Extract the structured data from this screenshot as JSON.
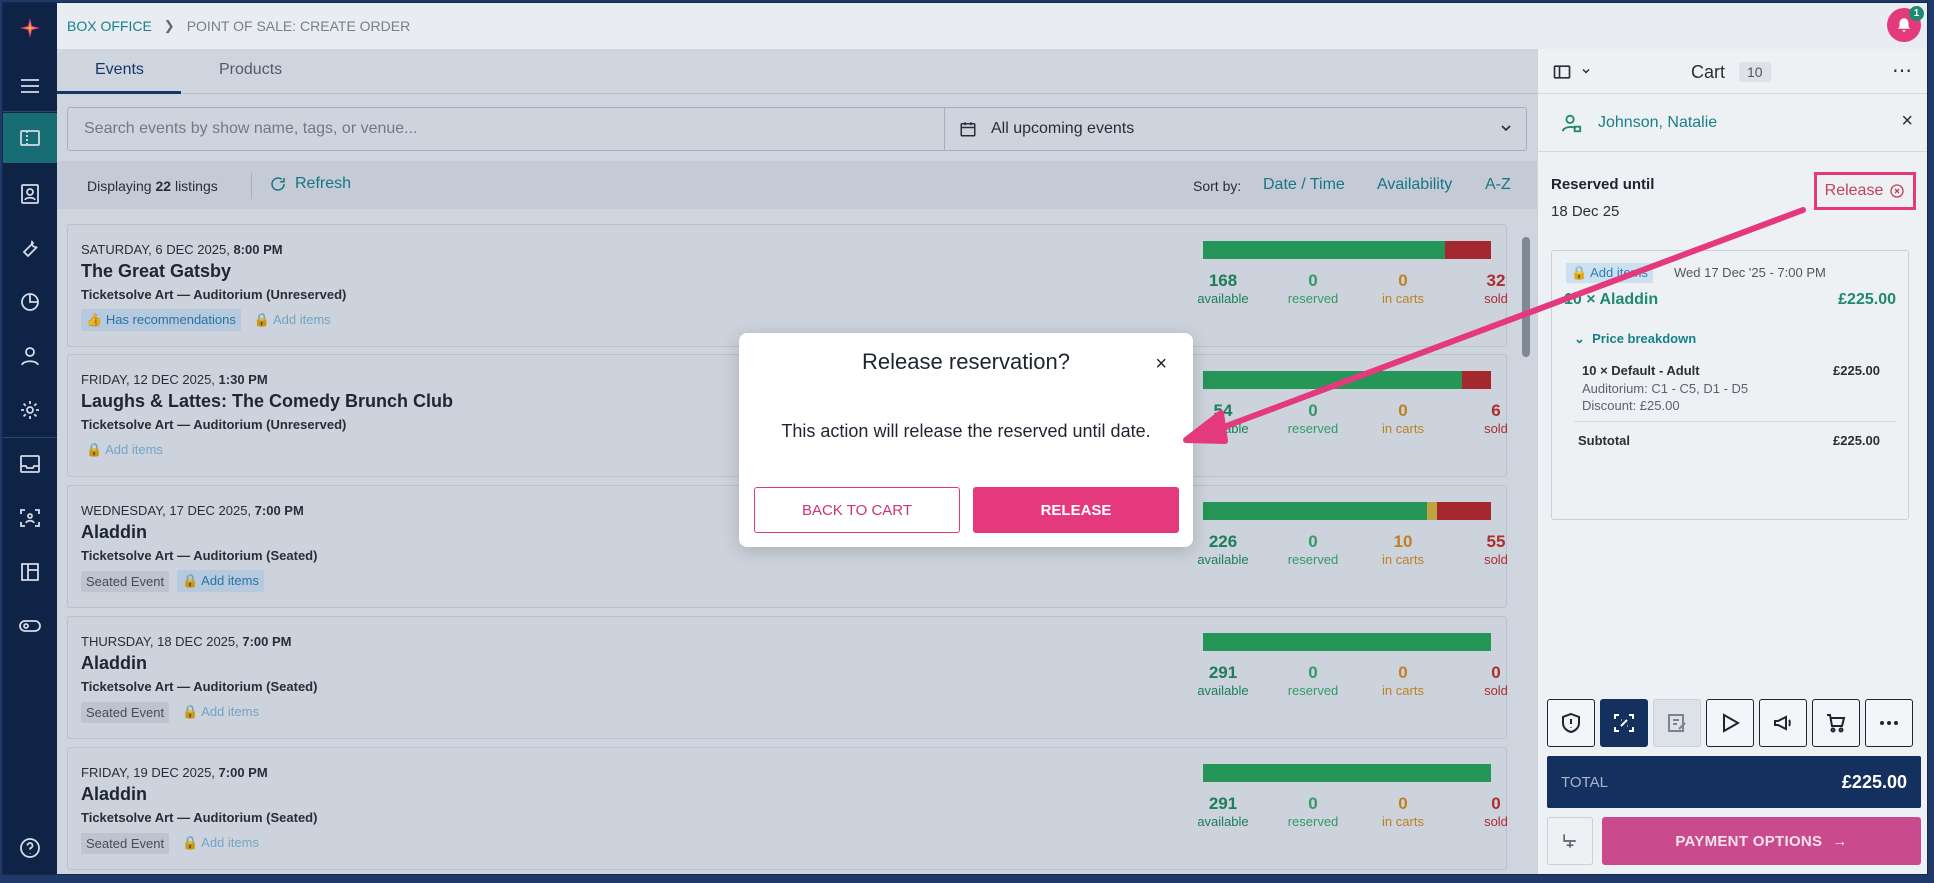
{
  "breadcrumb": {
    "root": "BOX OFFICE",
    "current": "POINT OF SALE: CREATE ORDER"
  },
  "notifications": {
    "count": "1"
  },
  "tabs": [
    {
      "label": "Events"
    },
    {
      "label": "Products"
    }
  ],
  "search": {
    "placeholder": "Search events by show name, tags, or venue...",
    "date_filter": "All upcoming events"
  },
  "listbar": {
    "displaying_prefix": "Displaying ",
    "displaying_count": "22",
    "displaying_suffix": " listings",
    "refresh": "Refresh",
    "sort_label": "Sort by:",
    "sort_options": [
      "Date / Time",
      "Availability",
      "A-Z"
    ]
  },
  "stat_labels": {
    "available": "available",
    "reserved": "reserved",
    "in_carts": "in carts",
    "sold": "sold"
  },
  "events": [
    {
      "date": "SATURDAY, 6 DEC 2025, ",
      "time": "8:00 PM",
      "name": "The Great Gatsby",
      "venue": "Ticketsolve Art — Auditorium (Unreserved)",
      "tag_primary": "Has recommendations",
      "add_items": "Add items",
      "available": 168,
      "reserved": 0,
      "in_carts": 0,
      "sold": 32
    },
    {
      "date": "FRIDAY, 12 DEC 2025, ",
      "time": "1:30 PM",
      "name": "Laughs & Lattes: The Comedy Brunch Club",
      "venue": "Ticketsolve Art — Auditorium (Unreserved)",
      "tag_primary": "",
      "add_items": "Add items",
      "available": 54,
      "reserved": 0,
      "in_carts": 0,
      "sold": 6
    },
    {
      "date": "WEDNESDAY, 17 DEC 2025, ",
      "time": "7:00 PM",
      "name": "Aladdin",
      "venue": "Ticketsolve Art — Auditorium (Seated)",
      "tag_primary": "Seated Event",
      "add_items": "Add items",
      "available": 226,
      "reserved": 0,
      "in_carts": 10,
      "sold": 55
    },
    {
      "date": "THURSDAY, 18 DEC 2025, ",
      "time": "7:00 PM",
      "name": "Aladdin",
      "venue": "Ticketsolve Art — Auditorium (Seated)",
      "tag_primary": "Seated Event",
      "add_items": "Add items",
      "available": 291,
      "reserved": 0,
      "in_carts": 0,
      "sold": 0
    },
    {
      "date": "FRIDAY, 19 DEC 2025, ",
      "time": "7:00 PM",
      "name": "Aladdin",
      "venue": "Ticketsolve Art — Auditorium (Seated)",
      "tag_primary": "Seated Event",
      "add_items": "Add items",
      "available": 291,
      "reserved": 0,
      "in_carts": 0,
      "sold": 0
    }
  ],
  "cart": {
    "title": "Cart",
    "count": "10",
    "customer": "Johnson, Natalie",
    "reserved_label": "Reserved until",
    "reserved_date": "18 Dec 25",
    "release_link": "Release",
    "add_items_tag": "Add items",
    "event_date": "Wed 17 Dec '25 - 7:00 PM",
    "line": "10 × Aladdin",
    "line_price": "£225.00",
    "breakdown_label": "Price breakdown",
    "item": "10 × Default - Adult",
    "item_price": "£225.00",
    "seats": "Auditorium: C1 - C5, D1 - D5",
    "discount": "Discount: £25.00",
    "subtotal_label": "Subtotal",
    "subtotal_value": "£225.00",
    "total_label": "TOTAL",
    "total_value": "£225.00",
    "pay_label": "PAYMENT OPTIONS"
  },
  "modal": {
    "title": "Release reservation?",
    "body": "This action will release the reserved until date.",
    "back_label": "BACK TO CART",
    "release_label": "RELEASE"
  },
  "colors": {
    "accent": "#e5397e",
    "nav": "#0f2347",
    "teal": "#17808a",
    "available": "#27a558",
    "in_carts": "#d8b642",
    "sold": "#b8282a"
  }
}
